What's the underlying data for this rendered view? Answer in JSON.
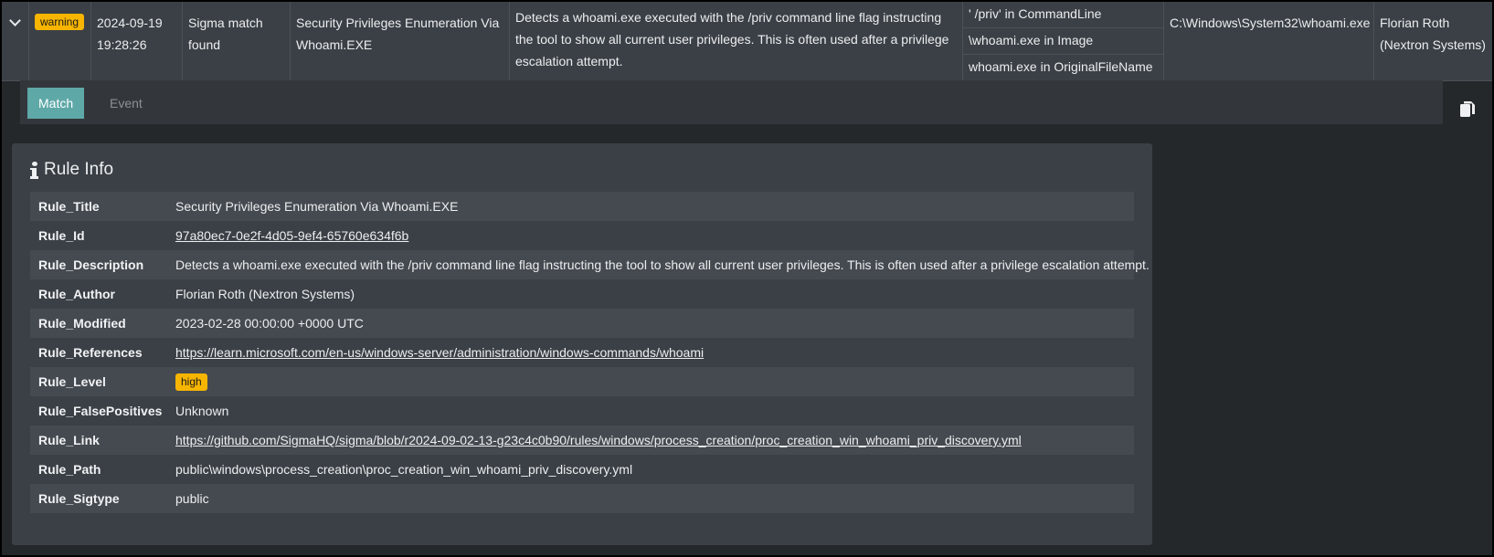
{
  "summary": {
    "level": "warning",
    "timestamp_date": "2024-09-19",
    "timestamp_time": "19:28:26",
    "event_title": "Sigma match found",
    "rule_title": "Security Privileges Enumeration Via Whoami.EXE",
    "description": "Detects a whoami.exe executed with the /priv command line flag instructing the tool to show all current user privileges. This is often used after a privilege escalation attempt.",
    "matches": [
      "' /priv' in CommandLine",
      "\\whoami.exe in Image",
      "whoami.exe in OriginalFileName"
    ],
    "image": "C:\\Windows\\System32\\whoami.exe",
    "author": "Florian Roth (Nextron Systems)"
  },
  "tabs": [
    {
      "label": "Match",
      "active": true
    },
    {
      "label": "Event",
      "active": false
    }
  ],
  "panel": {
    "title": "Rule Info",
    "rows": [
      {
        "key": "Rule_Title",
        "value": "Security Privileges Enumeration Via Whoami.EXE",
        "kind": "text"
      },
      {
        "key": "Rule_Id",
        "value": "97a80ec7-0e2f-4d05-9ef4-65760e634f6b",
        "kind": "link"
      },
      {
        "key": "Rule_Description",
        "value": "Detects a whoami.exe executed with the /priv command line flag instructing the tool to show all current user privileges. This is often used after a privilege escalation attempt.",
        "kind": "text"
      },
      {
        "key": "Rule_Author",
        "value": "Florian Roth (Nextron Systems)",
        "kind": "text"
      },
      {
        "key": "Rule_Modified",
        "value": "2023-02-28 00:00:00 +0000 UTC",
        "kind": "text"
      },
      {
        "key": "Rule_References",
        "value": "https://learn.microsoft.com/en-us/windows-server/administration/windows-commands/whoami",
        "kind": "link"
      },
      {
        "key": "Rule_Level",
        "value": "high",
        "kind": "badge"
      },
      {
        "key": "Rule_FalsePositives",
        "value": "Unknown",
        "kind": "text"
      },
      {
        "key": "Rule_Link",
        "value": "https://github.com/SigmaHQ/sigma/blob/r2024-09-02-13-g23c4c0b90/rules/windows/process_creation/proc_creation_win_whoami_priv_discovery.yml",
        "kind": "link"
      },
      {
        "key": "Rule_Path",
        "value": "public\\windows\\process_creation\\proc_creation_win_whoami_priv_discovery.yml",
        "kind": "text"
      },
      {
        "key": "Rule_Sigtype",
        "value": "public",
        "kind": "text"
      }
    ]
  },
  "colors": {
    "warning_badge": "#f7b500",
    "active_tab": "#5fa8a8",
    "panel_bg": "#3b4046",
    "page_bg": "#25282b"
  },
  "icons": {
    "expander": "chevron-down-icon",
    "copy": "copy-icon",
    "info": "info-icon"
  }
}
